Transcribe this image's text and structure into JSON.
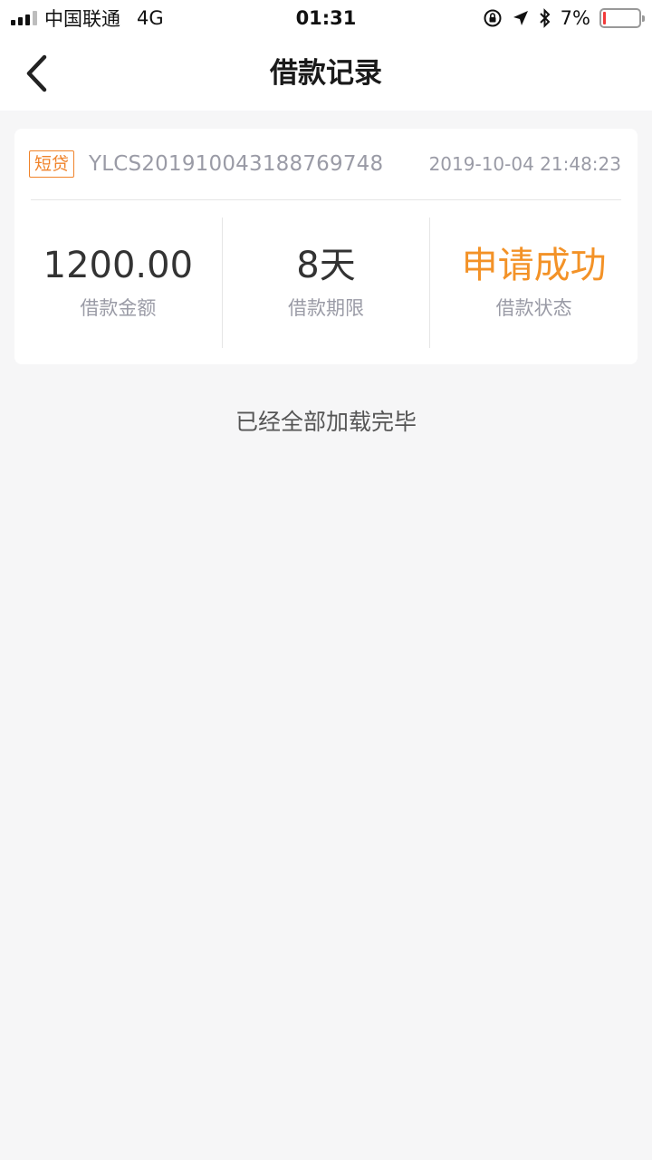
{
  "status_bar": {
    "carrier": "中国联通",
    "network": "4G",
    "time": "01:31",
    "battery_percent": "7%",
    "battery_level": 0.07,
    "icons": [
      "signal-icon",
      "orientation-lock-icon",
      "location-arrow-icon",
      "bluetooth-icon",
      "battery-icon"
    ]
  },
  "nav": {
    "title": "借款记录",
    "back_icon": "chevron-left-icon"
  },
  "loan_record": {
    "tag": "短贷",
    "loan_no": "YLCS20191004318876974​8",
    "datetime": "2019-10-04 21:48:23",
    "stats": [
      {
        "value": "1200.00",
        "label": "借款金额"
      },
      {
        "value": "8天",
        "label": "借款期限"
      },
      {
        "value": "申请成功",
        "label": "借款状态"
      }
    ]
  },
  "footer": {
    "load_status": "已经全部加载完毕"
  },
  "colors": {
    "accent": "#f39227",
    "tag_border": "#f0832a",
    "muted_text": "#9a9ba6",
    "background": "#f6f6f7"
  }
}
